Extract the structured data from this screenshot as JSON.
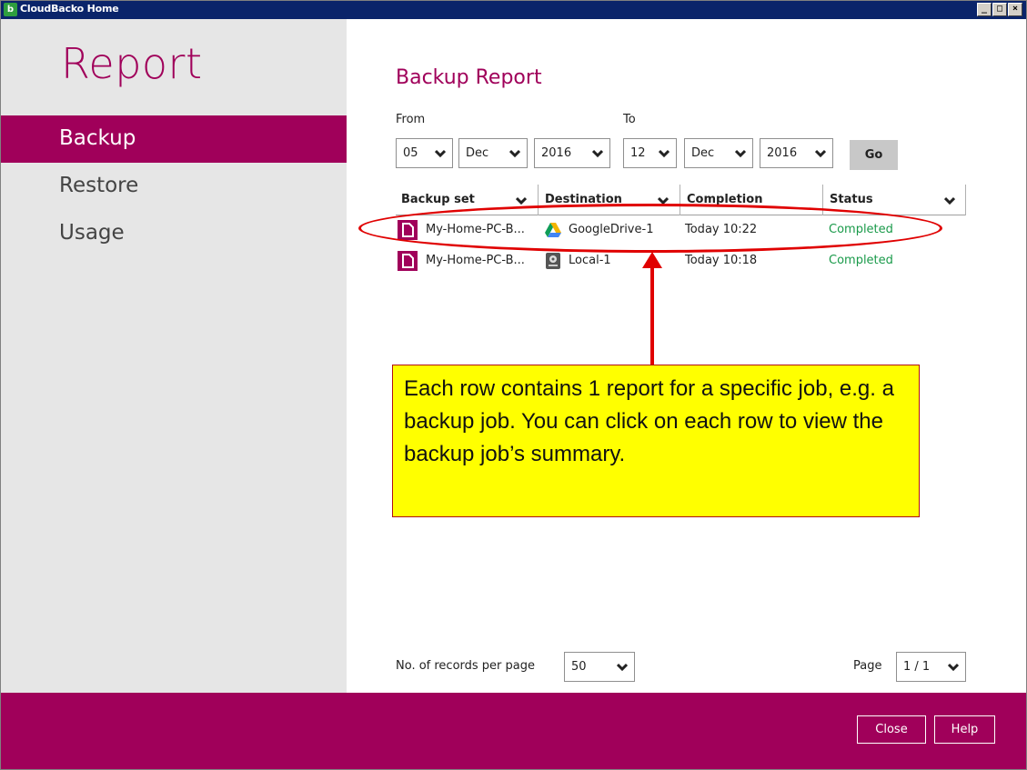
{
  "window": {
    "title": "CloudBacko Home",
    "min_glyph": "_",
    "max_glyph": "□",
    "close_glyph": "×"
  },
  "sidebar": {
    "heading": "Report",
    "items": [
      {
        "label": "Backup",
        "active": true
      },
      {
        "label": "Restore",
        "active": false
      },
      {
        "label": "Usage",
        "active": false
      }
    ]
  },
  "main": {
    "title": "Backup Report",
    "from_label": "From",
    "to_label": "To",
    "from": {
      "day": "05",
      "month": "Dec",
      "year": "2016"
    },
    "to": {
      "day": "12",
      "month": "Dec",
      "year": "2016"
    },
    "go_label": "Go",
    "columns": [
      "Backup set",
      "Destination",
      "Completion",
      "Status"
    ],
    "rows": [
      {
        "backup_set": "My-Home-PC-B...",
        "destination": "GoogleDrive-1",
        "destination_icon": "google-drive-icon",
        "completion": "Today 10:22",
        "status": "Completed"
      },
      {
        "backup_set": "My-Home-PC-B...",
        "destination": "Local-1",
        "destination_icon": "local-drive-icon",
        "completion": "Today 10:18",
        "status": "Completed"
      }
    ],
    "records_label": "No. of records per page",
    "records_value": "50",
    "page_label": "Page",
    "page_value": "1 / 1"
  },
  "annotation": {
    "callout_text": "Each row contains 1 report for a specific job, e.g. a backup job. You can click on each row to view the backup job’s summary."
  },
  "footer": {
    "close_label": "Close",
    "help_label": "Help"
  },
  "colors": {
    "brand": "#a0005a",
    "status_ok": "#1a9a4a",
    "callout_bg": "#ffff00",
    "annotation_red": "#e00000"
  }
}
